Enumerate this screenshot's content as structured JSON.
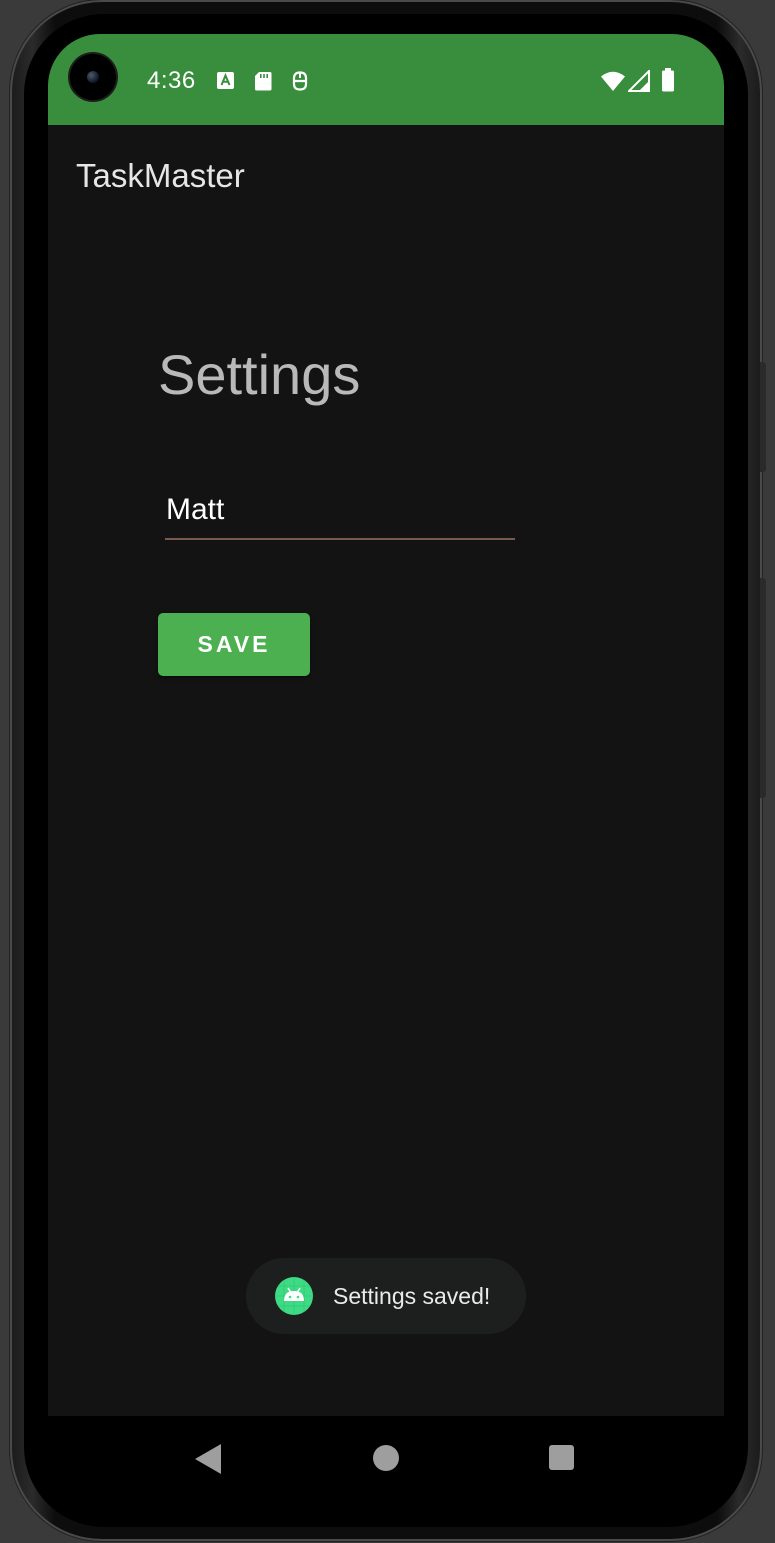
{
  "status_bar": {
    "time": "4:36",
    "background_color": "#388e3c",
    "left_icons": [
      "a-notification-icon",
      "sd-card-icon",
      "debug-icon"
    ],
    "right_icons": [
      "wifi-icon",
      "cellular-signal-icon",
      "battery-icon"
    ]
  },
  "app_bar": {
    "title": "TaskMaster"
  },
  "settings": {
    "heading": "Settings",
    "name_value": "Matt",
    "save_label": "SAVE",
    "save_color": "#4caf50"
  },
  "toast": {
    "message": "Settings saved!",
    "icon": "android-icon"
  },
  "nav_bar": {
    "buttons": [
      "back-icon",
      "home-icon",
      "recents-icon"
    ]
  }
}
